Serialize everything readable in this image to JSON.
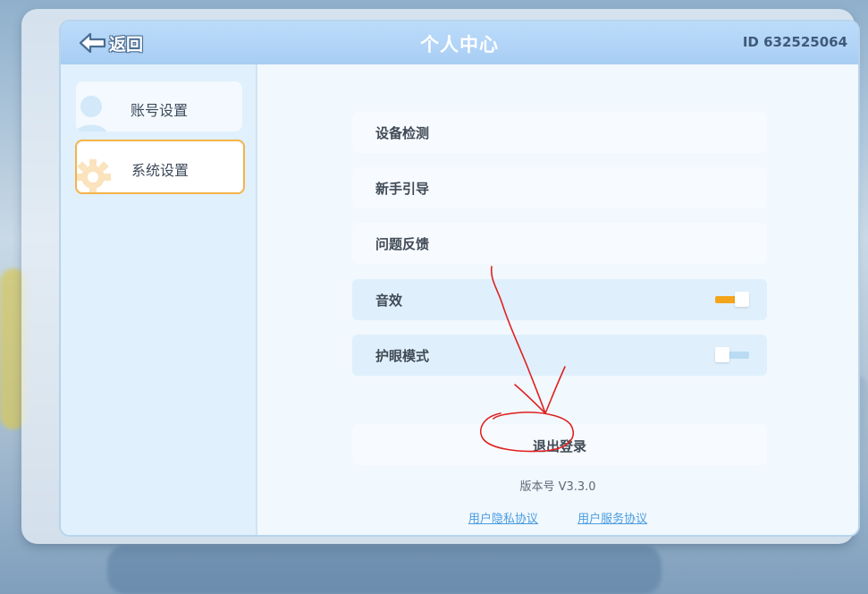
{
  "header": {
    "back_label": "返回",
    "title": "个人中心",
    "user_id": "ID 632525064"
  },
  "sidebar": {
    "items": [
      {
        "label": "账号设置",
        "icon": "user-icon",
        "active": false
      },
      {
        "label": "系统设置",
        "icon": "gear-icon",
        "active": true
      }
    ]
  },
  "settings": {
    "rows": [
      {
        "label": "设备检测"
      },
      {
        "label": "新手引导"
      },
      {
        "label": "问题反馈"
      },
      {
        "label": "音效",
        "toggle": "on"
      },
      {
        "label": "护眼模式",
        "toggle": "off"
      }
    ],
    "logout_label": "退出登录",
    "version": "版本号 V3.3.0",
    "privacy_link": "用户隐私协议",
    "service_link": "用户服务协议"
  },
  "colors": {
    "accent_orange": "#f5b24a",
    "toggle_on": "#f4a51c",
    "toggle_off": "#b9dcf4",
    "link": "#4a9ce0",
    "annotation": "#e02020"
  }
}
